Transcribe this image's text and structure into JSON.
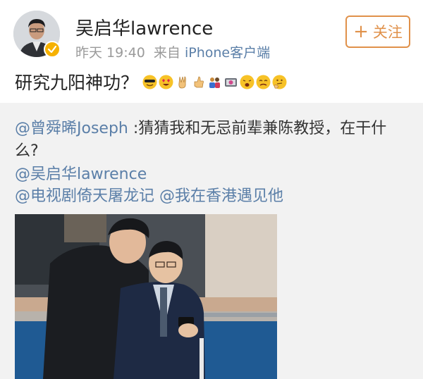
{
  "user": {
    "name": "吴启华lawrence",
    "time": "昨天 19:40",
    "from_prefix": "来自",
    "source": "iPhone客户端",
    "follow_label": "关注",
    "verified_color": "#f6b100"
  },
  "post": {
    "text": "研究九阳神功？",
    "emoji_icons": [
      "sunglasses-face-icon",
      "heart-eyes-face-icon",
      "victory-hand-icon",
      "thumbs-up-icon",
      "people-icon",
      "camera-icon",
      "tired-face-icon",
      "weary-face-icon",
      "thinking-face-icon"
    ]
  },
  "repost": {
    "mention1": "@曾舜晞Joseph",
    "text1a": " :猜猜我和无忌前辈兼陈教授，在干什",
    "text1b": "么?",
    "mention2": "@吴启华lawrence",
    "mention3": "@电视剧倚天屠龙记",
    "mention4": "@我在香港遇见他"
  },
  "colors": {
    "link": "#5b7fa8",
    "follow_accent": "#e0914a",
    "repost_bg": "#f2f2f2"
  }
}
